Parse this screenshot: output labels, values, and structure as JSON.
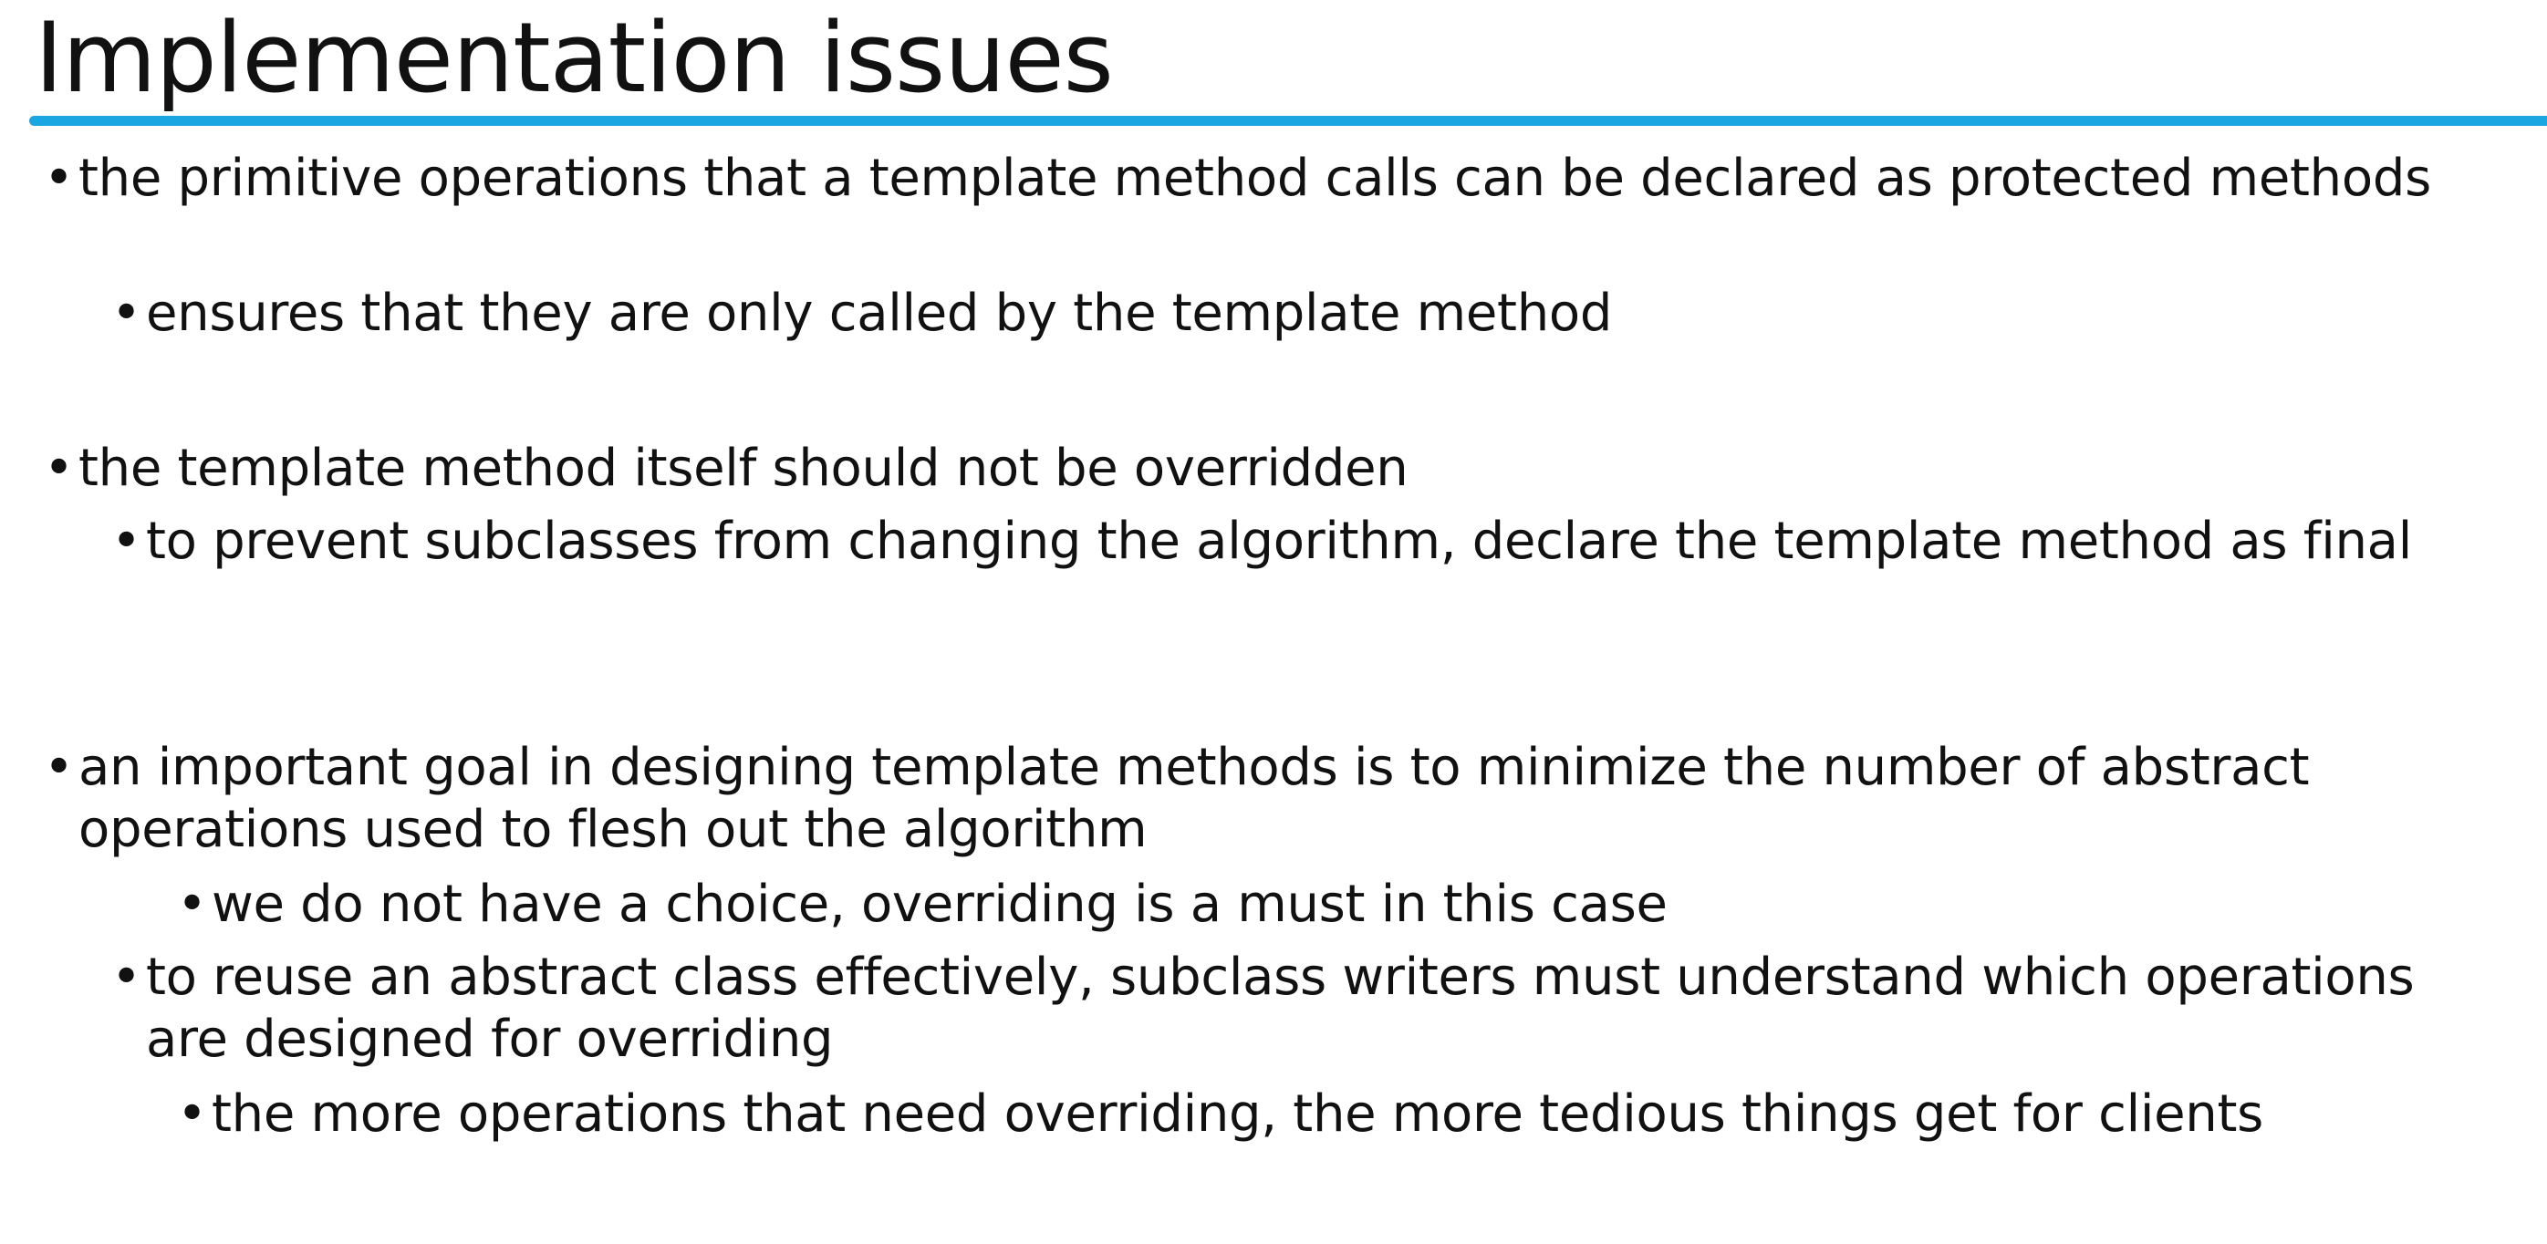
{
  "slide": {
    "title": "Implementation issues",
    "accent_color": "#1aa7e1",
    "bullet_glyph": "•",
    "items": [
      {
        "level": 1,
        "text": "the primitive operations that a template method calls can be declared as protected methods"
      },
      {
        "level": 2,
        "text": "ensures that they are only called by the template method"
      },
      {
        "level": 1,
        "text": "the template method itself should not be overridden"
      },
      {
        "level": 2,
        "text": "to prevent subclasses from changing the algorithm, declare the template method as final"
      },
      {
        "level": 1,
        "text": "an important goal in designing template methods is to minimize the number of abstract operations used to flesh out the algorithm"
      },
      {
        "level": 3,
        "text": "we do not have a choice, overriding is a must in this case"
      },
      {
        "level": 2,
        "text": "to reuse an abstract class effectively, subclass writers must understand which operations are designed for overriding"
      },
      {
        "level": 3,
        "text": "the more operations that need overriding, the more tedious things get for clients"
      }
    ]
  }
}
